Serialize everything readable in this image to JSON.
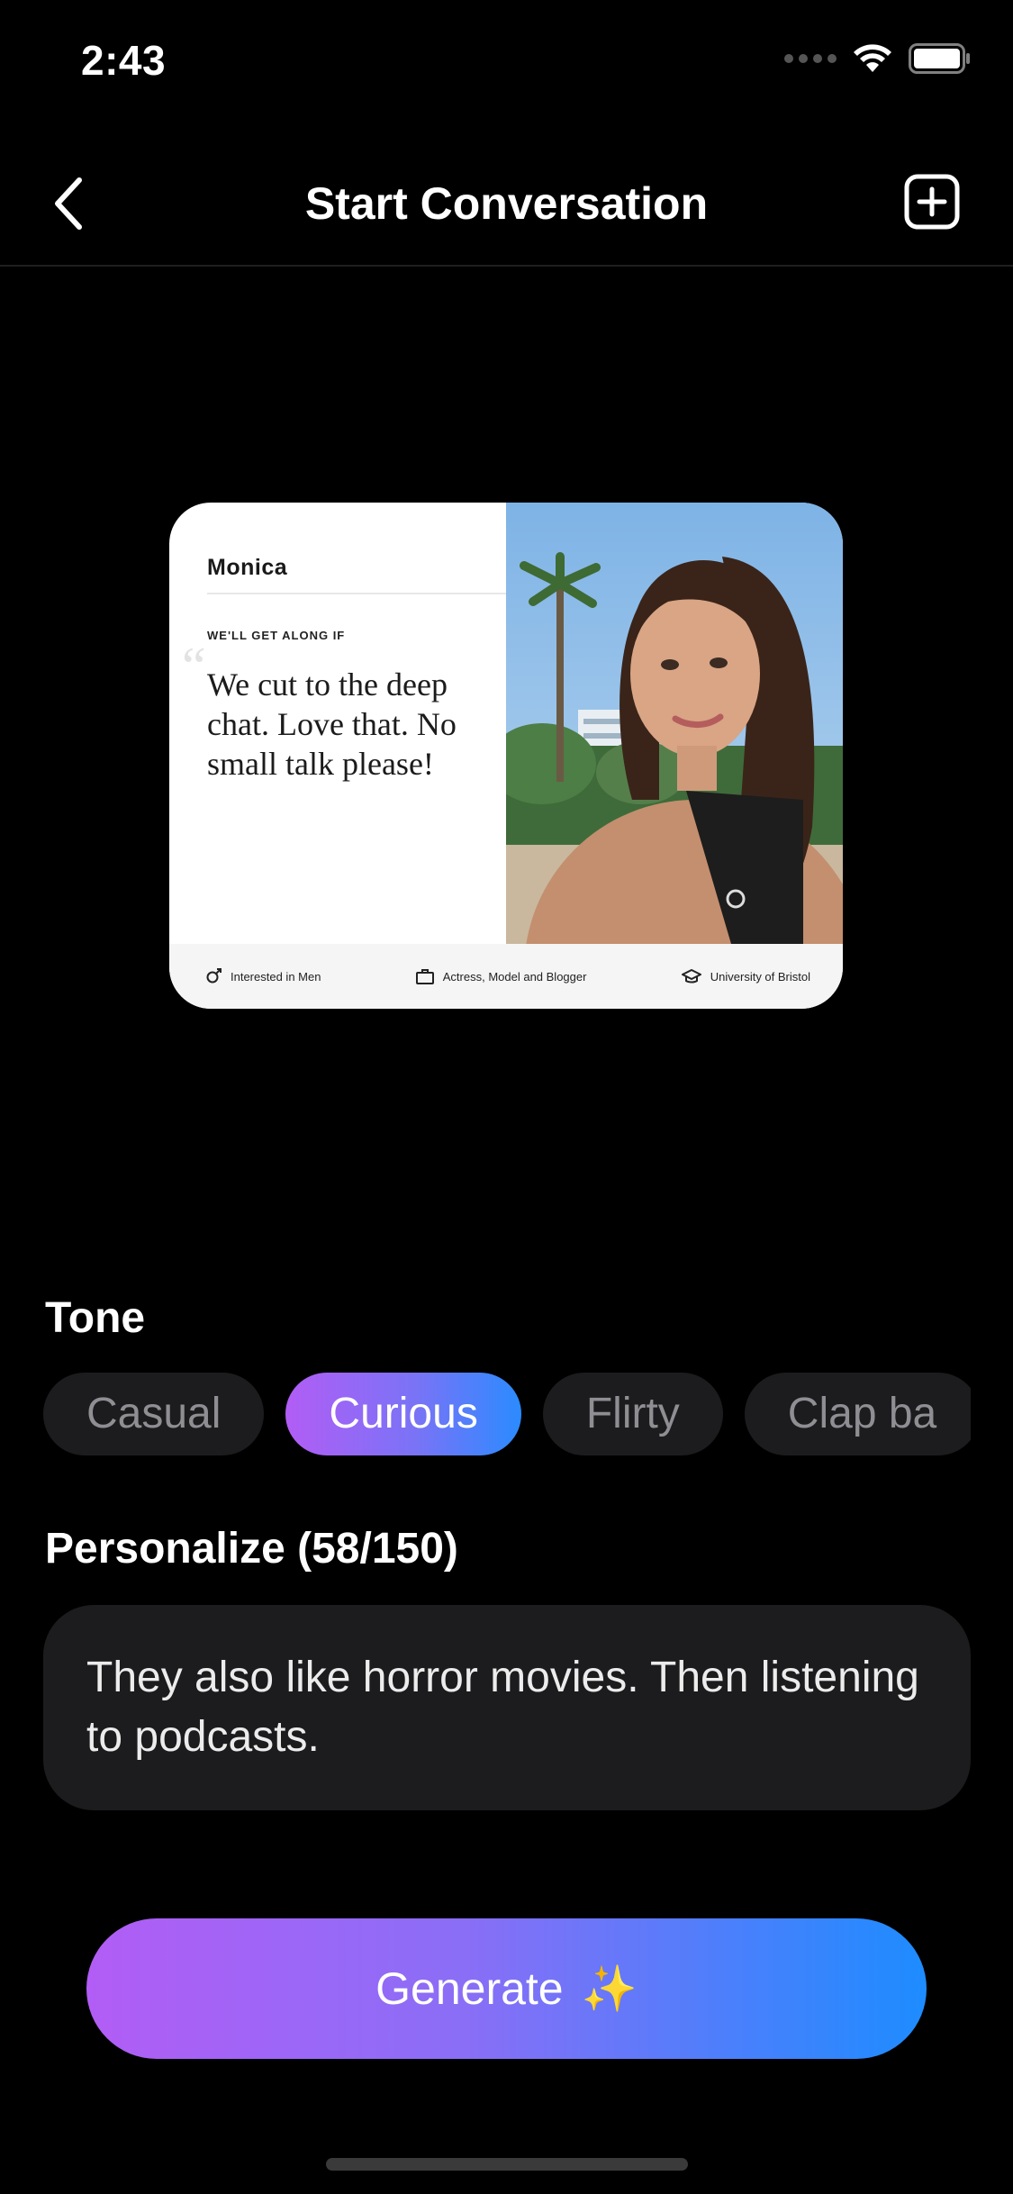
{
  "status_bar": {
    "time": "2:43"
  },
  "nav": {
    "title": "Start Conversation"
  },
  "profile_card": {
    "name": "Monica",
    "prompt_label": "WE'LL GET ALONG IF",
    "prompt_answer": "We cut to the deep chat. Love that. No small talk please!",
    "footer": {
      "interest": "Interested in Men",
      "job": "Actress, Model and Blogger",
      "school": "University of Bristol"
    }
  },
  "tone": {
    "label": "Tone",
    "options": [
      "Casual",
      "Curious",
      "Flirty",
      "Clap ba"
    ],
    "selected": "Curious"
  },
  "personalize": {
    "label": "Personalize (58/150)",
    "text": "They also like horror movies. Then listening to podcasts."
  },
  "generate": {
    "label": "Generate",
    "emoji": "✨"
  },
  "colors": {
    "gradient_start": "#b25df5",
    "gradient_end": "#1d8cff",
    "chip_background": "#1c1c1e"
  }
}
